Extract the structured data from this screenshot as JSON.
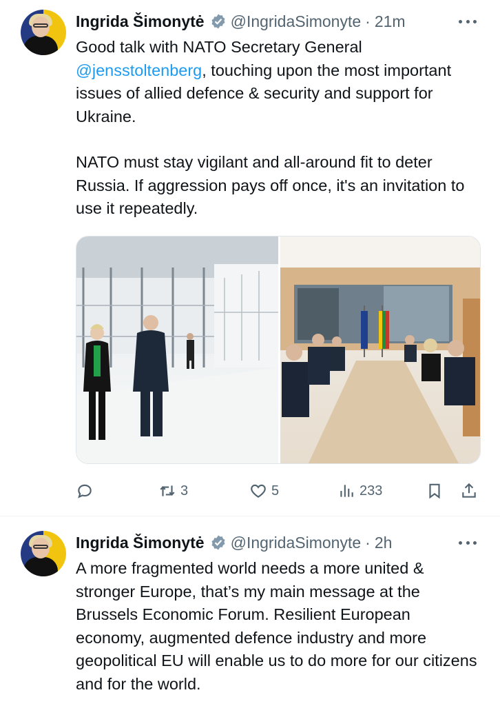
{
  "tweets": [
    {
      "author_name": "Ingrida Šimonytė",
      "handle": "@IngridaSimonyte",
      "separator": "·",
      "time": "21m",
      "text_para1_a": "Good talk with NATO Secretary General ",
      "mention": "@jensstoltenberg",
      "text_para1_b": ", touching upon the most important issues of allied defence & security and support for Ukraine.",
      "text_para2": "NATO must stay vigilant and all-around fit to deter Russia. If aggression pays off once, it's an invitation to use it repeatedly.",
      "actions": {
        "reply_count": "",
        "retweet_count": "3",
        "like_count": "5",
        "views_count": "233"
      }
    },
    {
      "author_name": "Ingrida Šimonytė",
      "handle": "@IngridaSimonyte",
      "separator": "·",
      "time": "2h",
      "text": "A more fragmented world needs a more united & stronger Europe, that’s my main message at the Brussels Economic Forum. Resilient European economy, augmented defence industry and more geopolitical EU will enable us to do more for our citizens and for the world."
    }
  ],
  "icons": {
    "verified": "verified-badge-icon",
    "more": "more-horizontal-icon",
    "reply": "reply-icon",
    "retweet": "retweet-icon",
    "like": "heart-icon",
    "views": "views-chart-icon",
    "bookmark": "bookmark-icon",
    "share": "share-icon"
  },
  "colors": {
    "text": "#0f1419",
    "secondary": "#536471",
    "link": "#1d9bf0",
    "verified": "#829aab"
  }
}
